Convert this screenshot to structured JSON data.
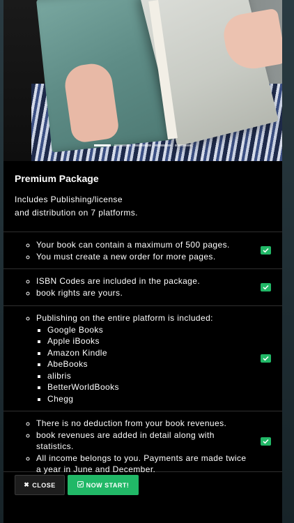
{
  "colors": {
    "accent": "#21b867",
    "panel_bg": "#000000",
    "divider": "#2f2f2f",
    "close_button_bg": "#1d1d1d"
  },
  "carousel": {
    "image": "woman holding an open teal book in front of her face",
    "slides": 5,
    "active_slide": 0
  },
  "package": {
    "title": "Premium Package",
    "description": "Includes Publishing/license\nand distribution on 7 platforms."
  },
  "features": [
    {
      "items": [
        "Your book can contain a maximum of 500 pages.",
        "You must create a new order for more pages."
      ],
      "icon": "check-icon"
    },
    {
      "items": [
        "ISBN Codes are included in the package.",
        "book rights are yours."
      ],
      "icon": "check-icon"
    },
    {
      "items": [
        "Publishing on the entire platform is included:"
      ],
      "platforms": [
        "Google Books",
        "Apple iBooks",
        "Amazon Kindle",
        "AbeBooks",
        "alibris",
        "BetterWorldBooks",
        "Chegg"
      ],
      "icon": "check-icon"
    },
    {
      "items": [
        "There is no deduction from your book revenues.",
        "book revenues are added in detail along with statistics.",
        "All income belongs to you. Payments are made twice a year in June and December."
      ],
      "icon": "check-icon"
    }
  ],
  "buttons": {
    "close_label": "CLOSE",
    "close_icon": "times-icon",
    "start_label": "NOW START!",
    "start_icon": "check-square-icon"
  }
}
